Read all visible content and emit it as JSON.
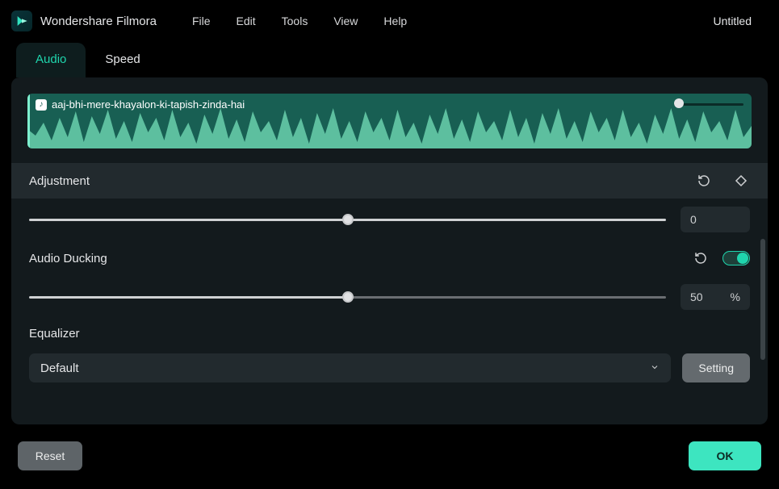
{
  "app": {
    "name": "Wondershare Filmora",
    "doc_title": "Untitled"
  },
  "menu": {
    "file": "File",
    "edit": "Edit",
    "tools": "Tools",
    "view": "View",
    "help": "Help"
  },
  "tabs": {
    "audio": "Audio",
    "speed": "Speed"
  },
  "clip": {
    "filename": "aaj-bhi-mere-khayalon-ki-tapish-zinda-hai"
  },
  "adjustment": {
    "title": "Adjustment",
    "pitch": {
      "value": "0",
      "slider_percent": 50
    }
  },
  "ducking": {
    "title": "Audio Ducking",
    "value": "50",
    "unit": "%",
    "slider_percent": 50,
    "enabled": true
  },
  "equalizer": {
    "title": "Equalizer",
    "selected": "Default",
    "setting_btn": "Setting"
  },
  "footer": {
    "reset": "Reset",
    "ok": "OK"
  },
  "icons": {
    "logo": "filmora-logo-icon",
    "revert": "revert-icon",
    "keyframe": "keyframe-diamond-icon",
    "chevron_down": "chevron-down-icon",
    "music": "music-note-icon"
  }
}
